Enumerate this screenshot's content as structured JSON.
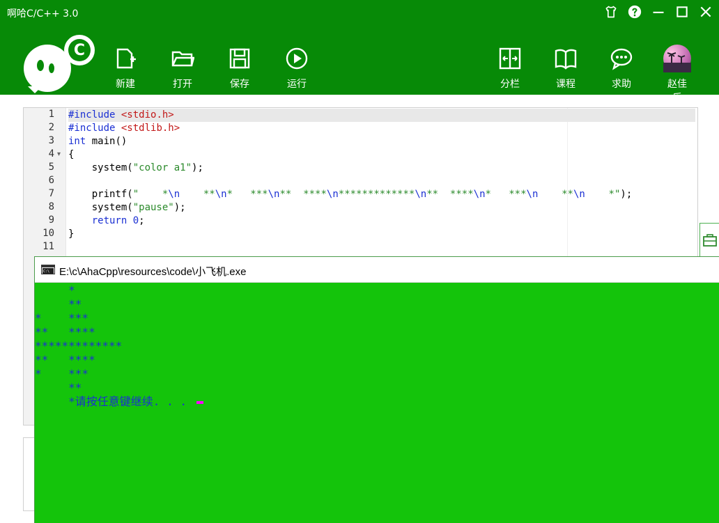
{
  "app": {
    "title": "啊哈C/C++ 3.0"
  },
  "toolbar": {
    "left": [
      {
        "label": "新建",
        "icon": "new-file-icon"
      },
      {
        "label": "打开",
        "icon": "open-folder-icon"
      },
      {
        "label": "保存",
        "icon": "save-icon"
      },
      {
        "label": "运行",
        "icon": "run-icon"
      }
    ],
    "right": [
      {
        "label": "分栏",
        "icon": "split-view-icon"
      },
      {
        "label": "课程",
        "icon": "book-icon"
      },
      {
        "label": "求助",
        "icon": "chat-help-icon"
      },
      {
        "label": "赵佳乐",
        "icon": "avatar"
      }
    ]
  },
  "editor": {
    "line_numbers": [
      "1",
      "2",
      "3",
      "4",
      "5",
      "6",
      "7",
      "8",
      "9",
      "10",
      "11"
    ]
  },
  "console": {
    "title": "E:\\c\\AhaCpp\\resources\\code\\小飞机.exe",
    "output_lines": [
      "     *",
      "     **",
      "*    ***",
      "**   ****",
      "*************",
      "**   ****",
      "*    ***",
      "     **",
      "     *请按任意键继续. . . "
    ]
  },
  "colors": {
    "toolbar_bg": "#078a07",
    "console_bg": "#14c40b",
    "console_text": "#1a2fd3",
    "cursor": "#ff00ff"
  }
}
